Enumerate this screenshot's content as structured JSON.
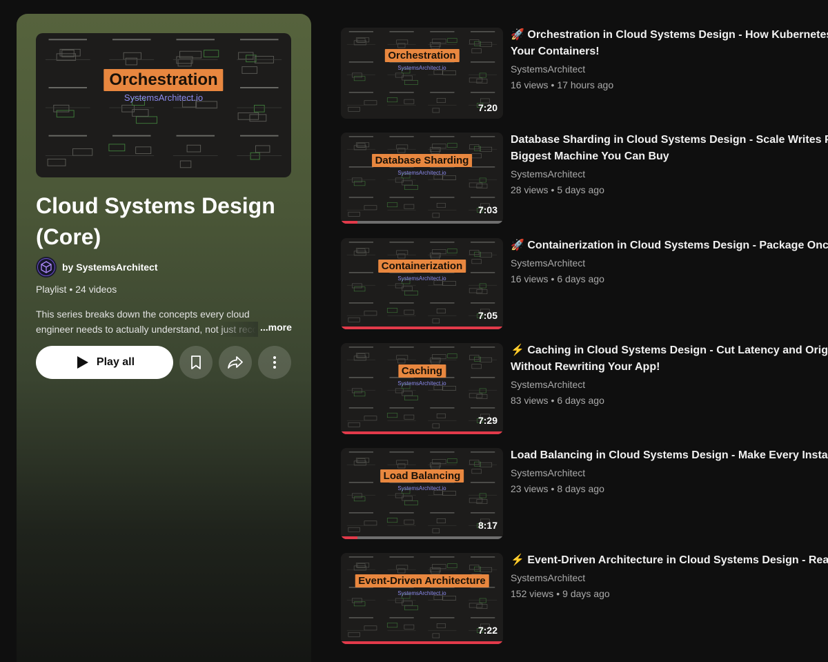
{
  "playlist": {
    "thumbnail_label": "Orchestration",
    "thumbnail_sub": "SystemsArchitect.io",
    "title": "Cloud Systems Design (Core)",
    "owner": "by SystemsArchitect",
    "type": "Playlist",
    "count": "24 videos",
    "description_line1": "This series breaks down the concepts every cloud",
    "description_line2": "engineer needs to actually understand, not just recognize",
    "more_label": "...more",
    "play_all_label": "Play all"
  },
  "videos": [
    {
      "emoji": "🚀",
      "title": "Orchestration in Cloud Systems Design - How Kubernetes Runs Your Containers!",
      "channel": "SystemsArchitect",
      "views": "16 views",
      "age": "17 hours ago",
      "duration": "7:20",
      "thumb_label": "Orchestration",
      "thumb_sub": "SystemsArchitect.io",
      "progress": 0
    },
    {
      "emoji": "",
      "title": "Database Sharding in Cloud Systems Design - Scale Writes Past the Biggest Machine You Can Buy",
      "channel": "SystemsArchitect",
      "views": "28 views",
      "age": "5 days ago",
      "duration": "7:03",
      "thumb_label": "Database Sharding",
      "thumb_sub": "SystemsArchitect.io",
      "progress": 0.1
    },
    {
      "emoji": "🚀",
      "title": "Containerization in Cloud Systems Design - Package Once, Run Anywhere",
      "channel": "SystemsArchitect",
      "views": "16 views",
      "age": "6 days ago",
      "duration": "7:05",
      "thumb_label": "Containerization",
      "thumb_sub": "SystemsArchitect.io",
      "progress": 1
    },
    {
      "emoji": "⚡",
      "title": "Caching in Cloud Systems Design - Cut Latency and Origin Load Without Rewriting Your App!",
      "channel": "SystemsArchitect",
      "views": "83 views",
      "age": "6 days ago",
      "duration": "7:29",
      "thumb_label": "Caching",
      "thumb_sub": "SystemsArchitect.io",
      "progress": 1
    },
    {
      "emoji": "",
      "title": "Load Balancing in Cloud Systems Design - Make Every Instance Count",
      "channel": "SystemsArchitect",
      "views": "23 views",
      "age": "8 days ago",
      "duration": "8:17",
      "thumb_label": "Load Balancing",
      "thumb_sub": "SystemsArchitect.io",
      "progress": 0.1
    },
    {
      "emoji": "⚡",
      "title": "Event-Driven Architecture in Cloud Systems Design - React to Change",
      "channel": "SystemsArchitect",
      "views": "152 views",
      "age": "9 days ago",
      "duration": "7:22",
      "thumb_label": "Event-Driven Architecture",
      "thumb_sub": "SystemsArchitect.io",
      "progress": 1
    }
  ],
  "icons": {
    "play": "play-icon",
    "save": "bookmark-icon",
    "share": "share-icon",
    "more": "more-vert-icon",
    "avatar": "cube-icon"
  },
  "colors": {
    "accent_progress": "#e23a4a",
    "thumb_label_bg": "#e8873f",
    "hero_gradient_top": "#56633d"
  }
}
